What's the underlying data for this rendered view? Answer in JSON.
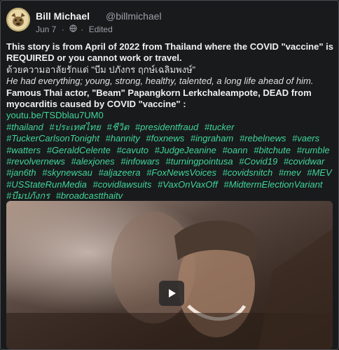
{
  "author": {
    "name": "Bill Michael",
    "handle": "@billmichael",
    "date": "Jun 7",
    "separator": "·",
    "edited": "Edited"
  },
  "post": {
    "headline": "This story is from April of 2022 from Thailand where the COVID \"vaccine\" is REQUIRED or you cannot work or travel.",
    "thai_line": "ด้วยความอาลัยรักแด่ \"บีม ปภังกร ฤกษ์เฉลิมพงษ์\"",
    "italic_line": "He had everything; young, strong, healthy, talented, a long life ahead of him.",
    "famous_line": "Famous Thai actor, \"Beam\" Papangkorn Lerkchaleampote, DEAD from myocarditis caused by COVID \"vaccine\" :",
    "link": "youtu.be/TSDblau7UM0",
    "hashtags": [
      "#thailand",
      "#ประเทศไทย",
      "#ชีวิต",
      "#presidentfraud",
      "#tucker",
      "#TuckerCarlsonTonight",
      "#hannity",
      "#foxnews",
      "#ingraham",
      "#rebelnews",
      "#vaers",
      "#watters",
      "#GeraldCelente",
      "#cavuto",
      "#JudgeJeanine",
      "#oann",
      "#bitchute",
      "#rumble",
      "#revolvernews",
      "#alexjones",
      "#infowars",
      "#turningpointusa",
      "#Covid19",
      "#covidwar",
      "#jan6th",
      "#skynewsau",
      "#aljazeera",
      "#FoxNewsVoices",
      "#covidsnitch",
      "#mev",
      "#MEV",
      "#USStateRunMedia",
      "#covidlawsuits",
      "#VaxOnVaxOff",
      "#MidtermElectionVariant",
      "#บีมปภังกร",
      "#broadcastthaitv"
    ]
  },
  "media": {
    "kind": "video",
    "play_icon": "play-icon"
  },
  "colors": {
    "background": "#191a1c",
    "accent": "#3fd79a",
    "text": "#e6e6e6",
    "muted": "#9aa0a6"
  }
}
